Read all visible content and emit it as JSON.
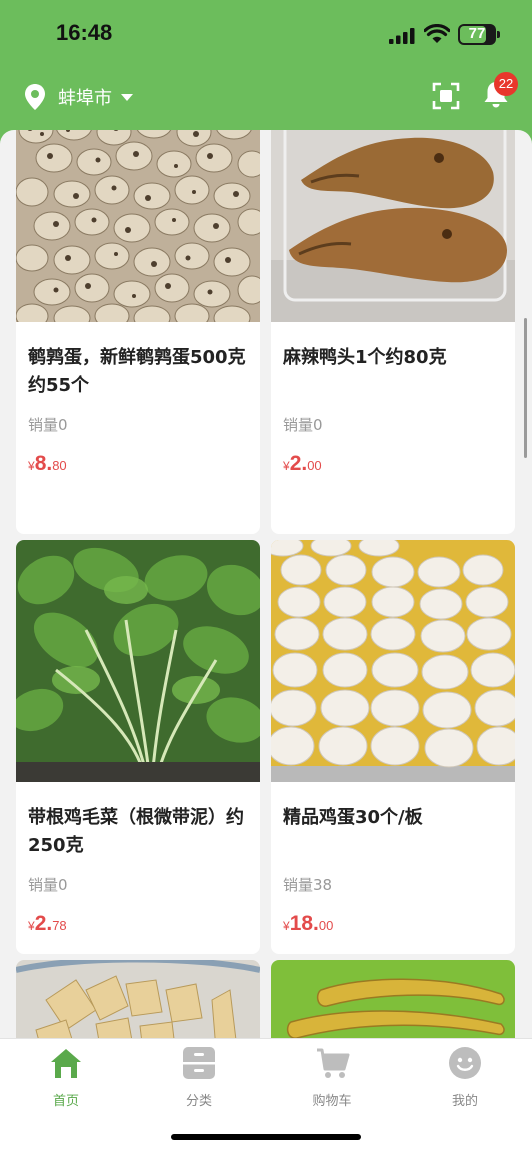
{
  "status_bar": {
    "time": "16:48",
    "battery": "77",
    "battery_level": 0.77
  },
  "header": {
    "city": "蚌埠市",
    "notification_count": "22",
    "icons": [
      "location-icon",
      "caret-down-icon",
      "scan-icon",
      "bell-icon"
    ]
  },
  "colors": {
    "brand_green": "#6cbd5c",
    "price_red": "#e34b4b",
    "badge_red": "#e8372c"
  },
  "products": [
    {
      "name": "鹌鹑蛋，新鲜鹌鹑蛋500克约55个",
      "sales": "销量0",
      "price_symbol": "¥",
      "price_int": "8.",
      "price_dec": "80"
    },
    {
      "name": "麻辣鸭头1个约80克",
      "sales": "销量0",
      "price_symbol": "¥",
      "price_int": "2.",
      "price_dec": "00"
    },
    {
      "name": "带根鸡毛菜（根微带泥）约250克",
      "sales": "销量0",
      "price_symbol": "¥",
      "price_int": "2.",
      "price_dec": "78"
    },
    {
      "name": "精品鸡蛋30个/板",
      "sales": "销量38",
      "price_symbol": "¥",
      "price_int": "18.",
      "price_dec": "00"
    }
  ],
  "tabbar": {
    "tabs": [
      {
        "label": "首页",
        "icon": "home-icon",
        "active": true
      },
      {
        "label": "分类",
        "icon": "category-icon",
        "active": false
      },
      {
        "label": "购物车",
        "icon": "cart-icon",
        "active": false
      },
      {
        "label": "我的",
        "icon": "profile-icon",
        "active": false
      }
    ]
  }
}
